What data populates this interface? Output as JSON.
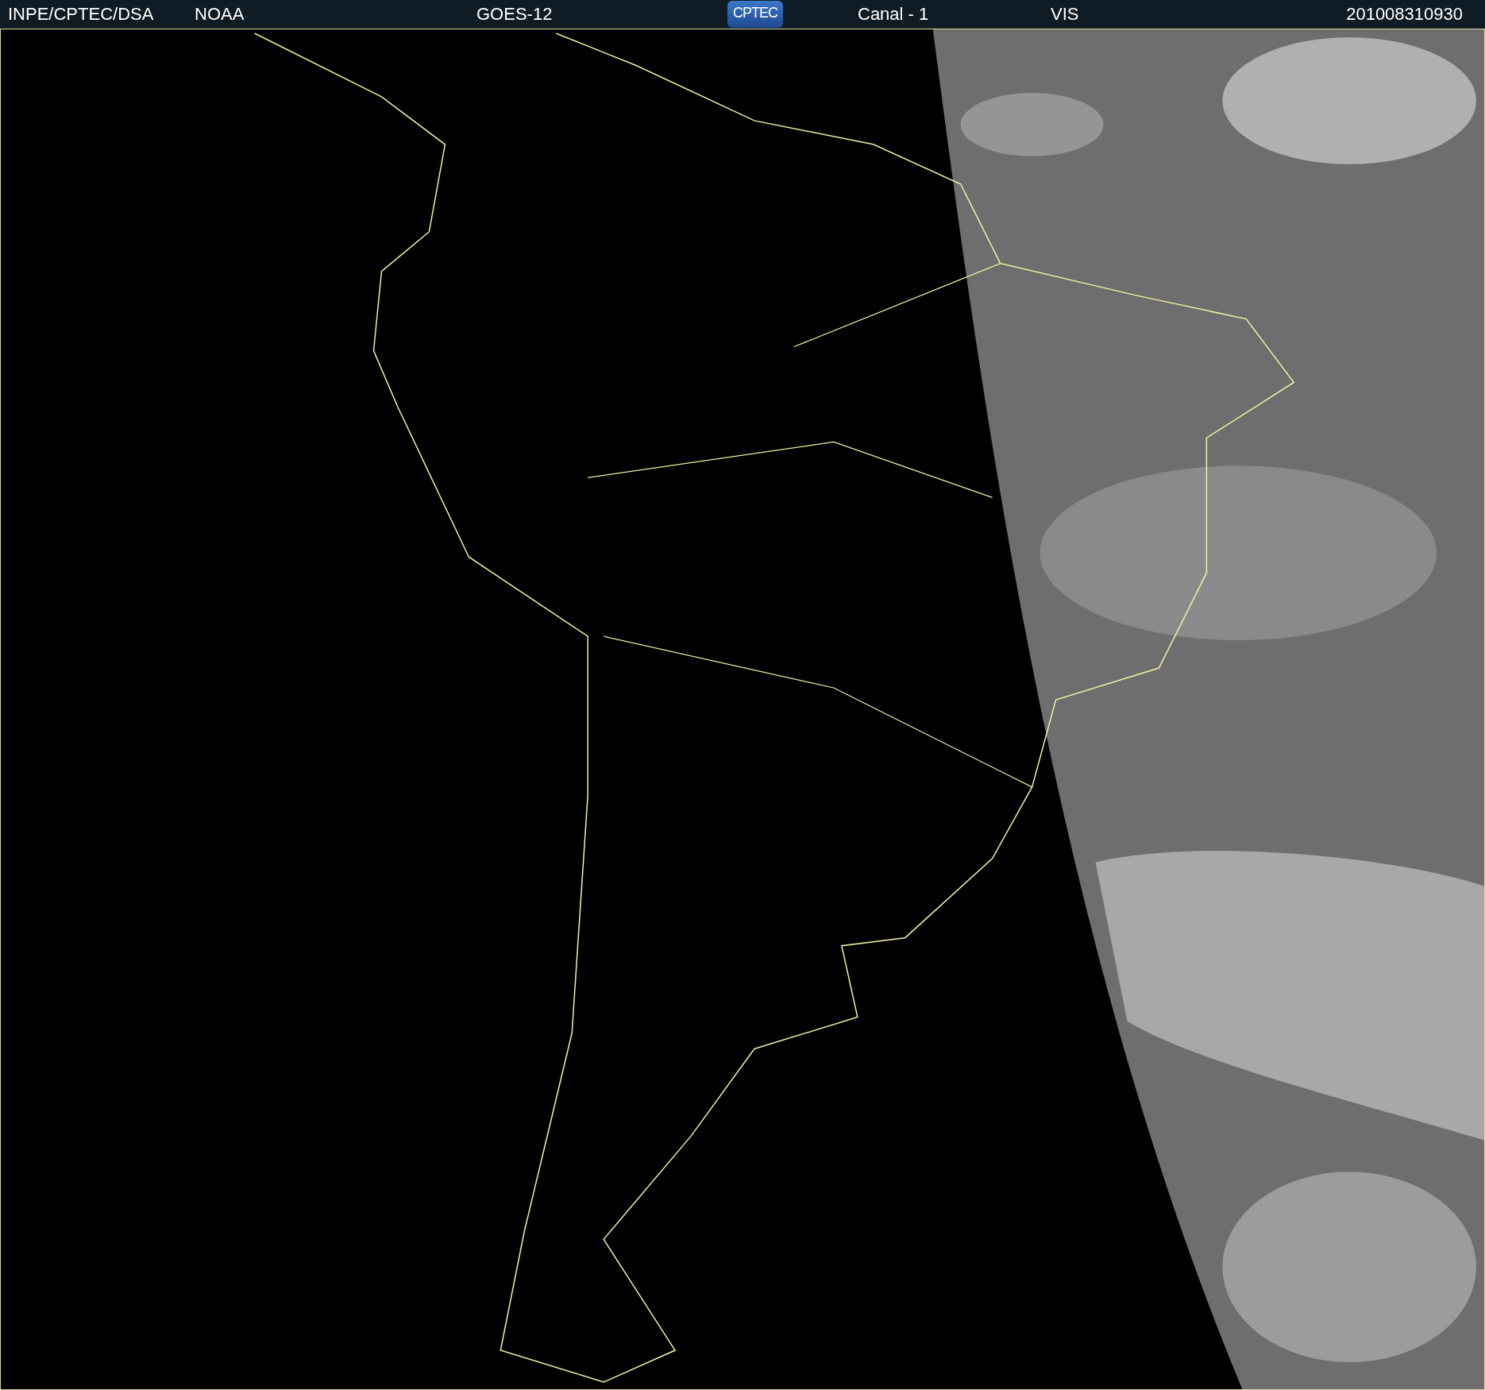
{
  "header": {
    "items": [
      {
        "kind": "text",
        "text": "INPE/CPTEC/DSA"
      },
      {
        "kind": "text",
        "text": "NOAA"
      },
      {
        "kind": "text",
        "text": "GOES-12"
      },
      {
        "kind": "logo",
        "text": "CPTEC"
      },
      {
        "kind": "text",
        "text": "Canal - 1"
      },
      {
        "kind": "text",
        "text": "VIS"
      },
      {
        "kind": "text",
        "text": "201008310930"
      }
    ]
  }
}
